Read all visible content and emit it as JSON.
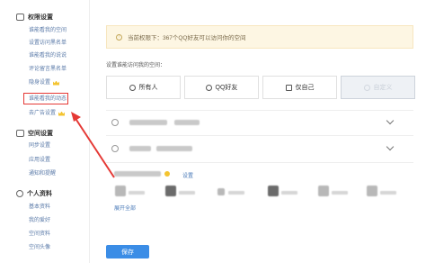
{
  "sidebar": {
    "sections": [
      {
        "title": "权限设置",
        "items": [
          {
            "label": "谁能看我的空间"
          },
          {
            "label": "设置访问黑名单"
          },
          {
            "label": "谁能看我的说说"
          },
          {
            "label": "评论留言黑名单"
          },
          {
            "label": "隐身设置",
            "vip": true
          },
          {
            "label": "谁能看我的动态",
            "highlighted": true
          },
          {
            "label": "去广告设置",
            "vip": true
          }
        ]
      },
      {
        "title": "空间设置",
        "items": [
          {
            "label": "同步设置"
          },
          {
            "label": "应用设置"
          },
          {
            "label": "通知和提醒"
          }
        ]
      },
      {
        "title": "个人资料",
        "items": [
          {
            "label": "基本资料"
          },
          {
            "label": "我的爱好"
          },
          {
            "label": "空间资料"
          },
          {
            "label": "空间头像"
          }
        ]
      }
    ]
  },
  "notice": {
    "text": "当前权限下：367个QQ好友可以访问你的空间"
  },
  "permission": {
    "label": "设置谁能访问我的空间：",
    "options": [
      {
        "label": "所有人",
        "icon": "globe-icon"
      },
      {
        "label": "QQ好友",
        "icon": "friends-icon"
      },
      {
        "label": "仅自己",
        "icon": "lock-icon"
      },
      {
        "label": "自定义",
        "icon": "custom-icon",
        "selected": true
      }
    ]
  },
  "friends": {
    "settings_link": "设置",
    "expand_all": "展开全部"
  },
  "actions": {
    "save_label": "保存"
  },
  "colors": {
    "accent": "#3b8de6",
    "link": "#5a7aa8",
    "highlight": "#e53935",
    "vip": "#f4c430"
  }
}
